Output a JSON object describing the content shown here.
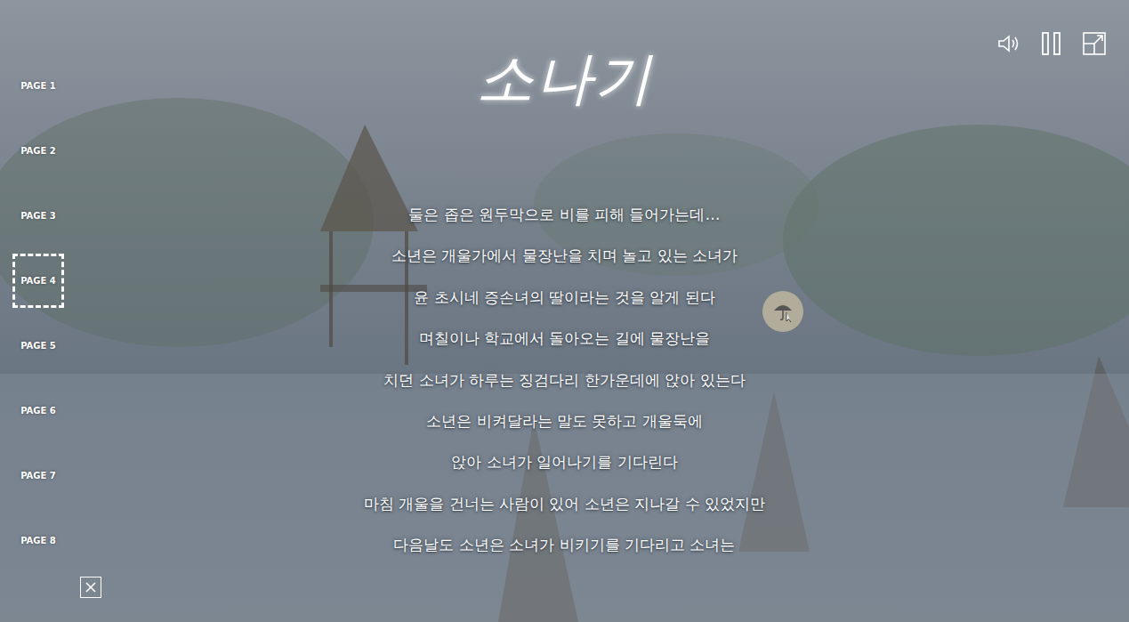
{
  "title": "소나기",
  "pages": [
    {
      "label": "PAGE 1",
      "selected": false
    },
    {
      "label": "PAGE 2",
      "selected": false
    },
    {
      "label": "PAGE 3",
      "selected": false
    },
    {
      "label": "PAGE 4",
      "selected": true
    },
    {
      "label": "PAGE 5",
      "selected": false
    },
    {
      "label": "PAGE 6",
      "selected": false
    },
    {
      "label": "PAGE 7",
      "selected": false
    },
    {
      "label": "PAGE 8",
      "selected": false
    }
  ],
  "story_lines": [
    "둘은 좁은 원두막으로 비를 피해 들어가는데…",
    "소년은 개울가에서 물장난을 치며 놀고 있는 소녀가",
    "윤 초시네 증손녀의 딸이라는 것을 알게 된다",
    "며칠이나 학교에서 돌아오는 길에 물장난을",
    "치던 소녀가 하루는 징검다리 한가운데에 앉아 있는다",
    "소년은 비켜달라는 말도 못하고 개울둑에",
    "앉아 소녀가 일어나기를 기다린다",
    "마침 개울을 건너는 사람이 있어 소년은 지나갈 수 있었지만",
    "다음날도 소년은 소녀가 비키기를 기다리고 소녀는"
  ]
}
